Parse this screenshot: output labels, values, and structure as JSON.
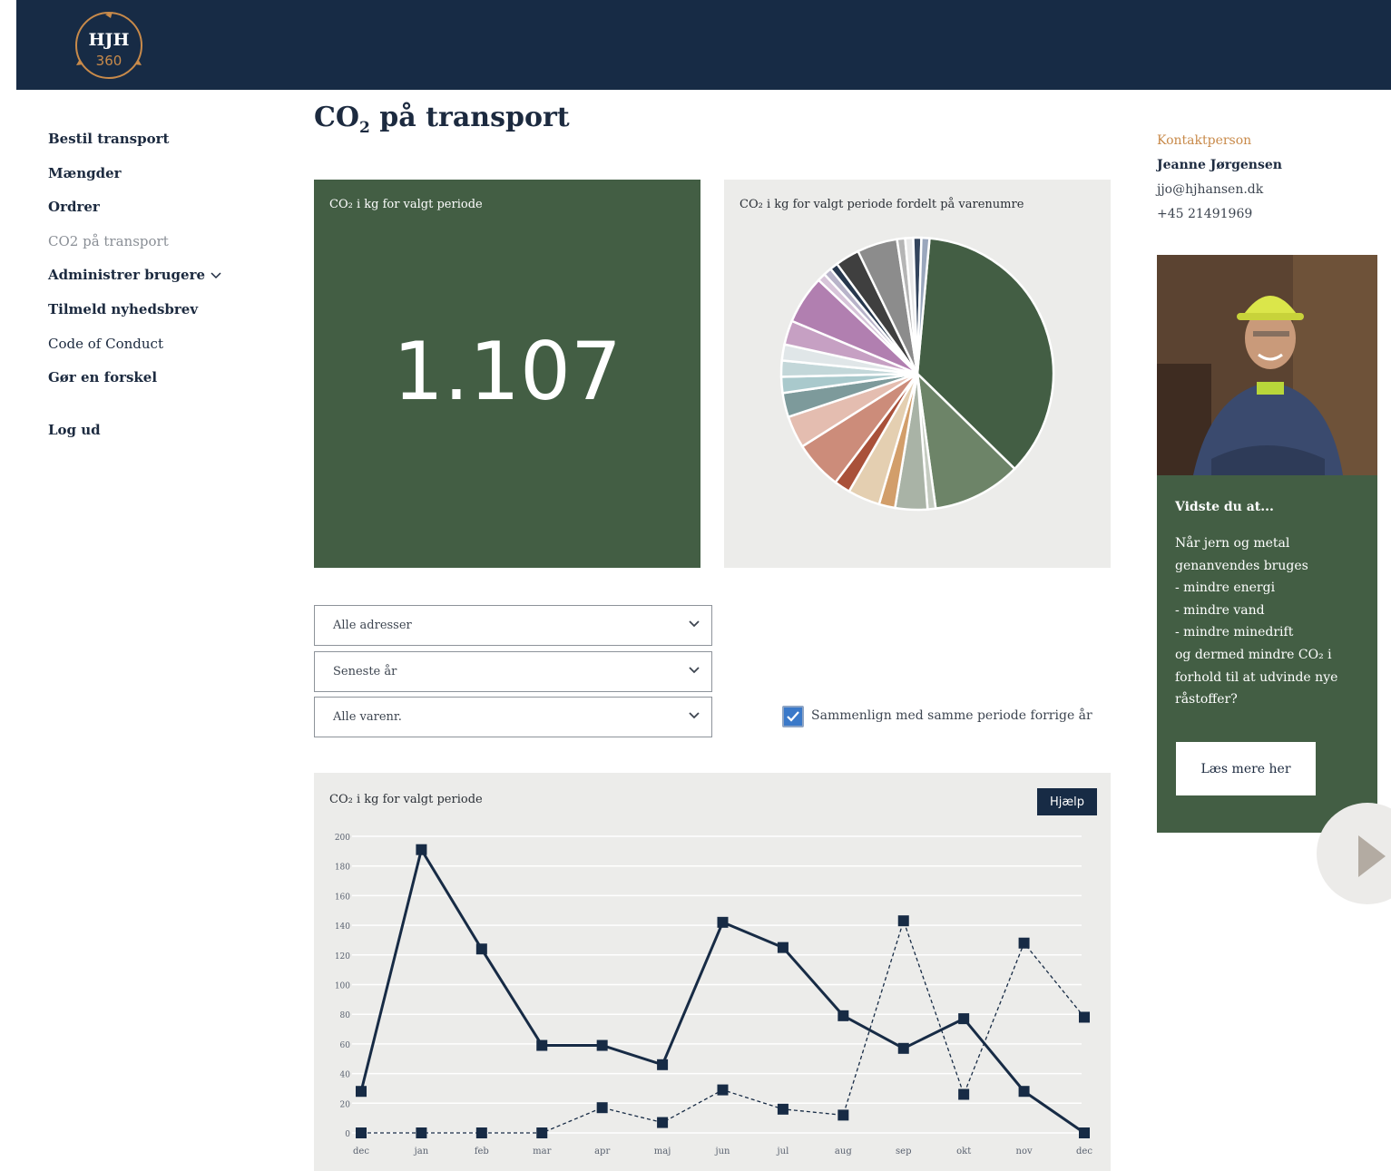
{
  "header": {
    "logo_text": "HJH",
    "logo_sub": "360"
  },
  "sidebar": {
    "items": [
      {
        "label": "Bestil transport"
      },
      {
        "label": "Mængder"
      },
      {
        "label": "Ordrer"
      },
      {
        "label": "CO2 på transport"
      },
      {
        "label": "Administrer brugere"
      },
      {
        "label": "Tilmeld nyhedsbrev"
      },
      {
        "label": "Code of Conduct"
      },
      {
        "label": "Gør en forskel"
      }
    ],
    "logout": "Log ud"
  },
  "page": {
    "title_main": "CO",
    "title_sub": "2",
    "title_rest": " på transport"
  },
  "kpi": {
    "title": "CO₂ i kg for valgt periode",
    "value": "1.107"
  },
  "pie": {
    "title": "CO₂ i kg for valgt periode fordelt på varenumre"
  },
  "filters": {
    "address": "Alle adresser",
    "period": "Seneste år",
    "item": "Alle varenr."
  },
  "compare": {
    "checked": true,
    "label": "Sammenlign med samme periode forrige år"
  },
  "line_chart_panel": {
    "title": "CO₂ i kg for valgt periode",
    "help": "Hjælp"
  },
  "chart_data": [
    {
      "type": "pie",
      "title": "CO₂ i kg for valgt periode fordelt på varenumre",
      "values": [
        37.5,
        11,
        1,
        4,
        2,
        4,
        2,
        6,
        4,
        3,
        2,
        2,
        2,
        3,
        6,
        1,
        1,
        1,
        3,
        5,
        1,
        1,
        1,
        1
      ],
      "colors": [
        "#435e44",
        "#6d8468",
        "#c4cbc0",
        "#a9b3a6",
        "#d29e6a",
        "#e4cfb1",
        "#a9513a",
        "#cc8c7a",
        "#e4bdb0",
        "#7d9a9b",
        "#a9c9cc",
        "#c3d7d9",
        "#e0e6e8",
        "#c6a0c3",
        "#b17fb0",
        "#d7c4d9",
        "#b8b3c9",
        "#27374d",
        "#3f3f3f",
        "#8c8c8c",
        "#b5b5b5",
        "#e8e8e8",
        "#33445c",
        "#9aa7bd"
      ]
    },
    {
      "type": "line",
      "title": "CO₂ i kg for valgt periode",
      "categories": [
        "dec",
        "jan",
        "feb",
        "mar",
        "apr",
        "maj",
        "jun",
        "jul",
        "aug",
        "sep",
        "okt",
        "nov",
        "dec"
      ],
      "ylim": [
        0,
        200
      ],
      "yticks": [
        0,
        20,
        40,
        60,
        80,
        100,
        120,
        140,
        160,
        180,
        200
      ],
      "grid": true,
      "series": [
        {
          "values": [
            28,
            191,
            124,
            59,
            59,
            46,
            142,
            125,
            79,
            57,
            77,
            28,
            0
          ],
          "style": "solid"
        },
        {
          "values": [
            0,
            0,
            0,
            0,
            17,
            7,
            29,
            16,
            12,
            143,
            26,
            128,
            78
          ],
          "style": "dashed"
        }
      ]
    }
  ],
  "contact": {
    "label": "Kontaktperson",
    "name": "Jeanne Jørgensen",
    "email": "jjo@hjhansen.dk",
    "phone": "+45 21491969"
  },
  "promo": {
    "title": "Vidste du at...",
    "lines": [
      "Når jern og metal",
      "genanvendes bruges",
      "- mindre energi",
      "- mindre vand",
      "- mindre minedrift",
      "og dermed mindre CO₂ i",
      "forhold til at udvinde nye",
      "råstoffer?"
    ],
    "button": "Læs mere her"
  }
}
